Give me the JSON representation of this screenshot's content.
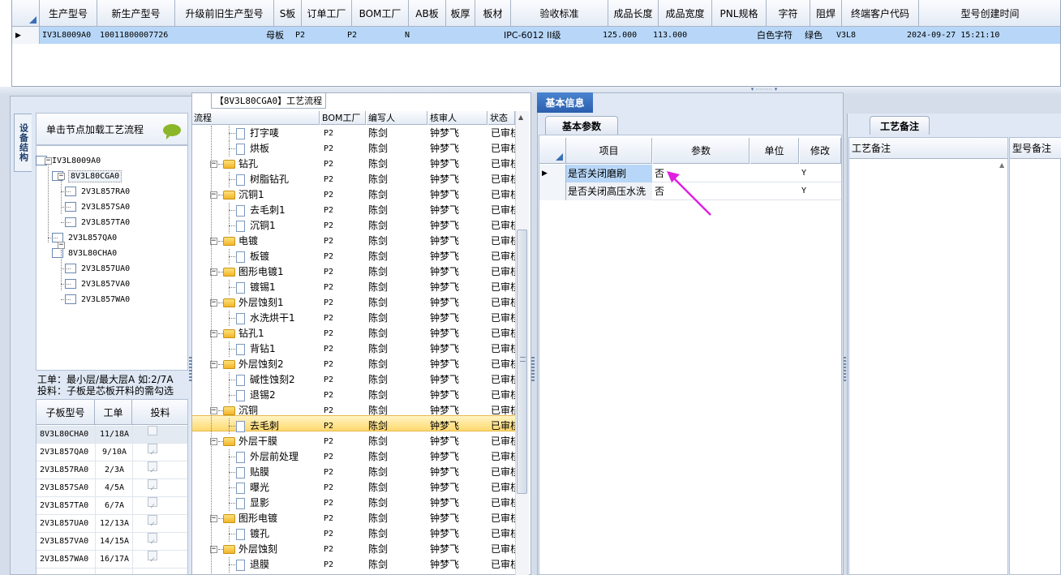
{
  "top_grid": {
    "headers": [
      "生产型号",
      "新生产型号",
      "升级前旧生产型号",
      "S板",
      "订单工厂",
      "BOM工厂",
      "AB板",
      "板厚",
      "板材",
      "验收标准",
      "成品长度",
      "成品宽度",
      "PNL规格",
      "字符",
      "阻焊",
      "终端客户代码",
      "型号创建时间"
    ],
    "row": {
      "model": "IV3L8009A0",
      "new_model": "10011800007726",
      "old_model": "",
      "s_board": "母板",
      "order_factory": "P2",
      "bom_factory": "P2",
      "ab": "N",
      "thickness": "",
      "material": "",
      "standard": "IPC-6012 II级",
      "length": "125.000",
      "width": "113.000",
      "pnl": "",
      "char": "白色字符",
      "mask": "绿色",
      "customer": "V3L8",
      "created": "2024-09-27 15:21:10"
    }
  },
  "left": {
    "vertical_tab": "设备结构",
    "hint": "单击节点加载工艺流程",
    "tree": [
      {
        "label": "IV3L8009A0"
      },
      {
        "label": "8V3L80CGA0"
      },
      {
        "label": "2V3L857RA0"
      },
      {
        "label": "2V3L857SA0"
      },
      {
        "label": "2V3L857TA0"
      },
      {
        "label": "2V3L857QA0"
      },
      {
        "label": "8V3L80CHA0"
      },
      {
        "label": "2V3L857UA0"
      },
      {
        "label": "2V3L857VA0"
      },
      {
        "label": "2V3L857WA0"
      }
    ],
    "note_line1": "工单：最小层/最大层A 如:2/7A",
    "note_line2": "投料：子板是芯板开料的需勾选",
    "sub_headers": [
      "子板型号",
      "工单",
      "投料"
    ],
    "sub_rows": [
      {
        "model": "8V3L80CHA0",
        "wo": "11/18A",
        "checked": false
      },
      {
        "model": "2V3L857QA0",
        "wo": "9/10A",
        "checked": true
      },
      {
        "model": "2V3L857RA0",
        "wo": "2/3A",
        "checked": true
      },
      {
        "model": "2V3L857SA0",
        "wo": "4/5A",
        "checked": true
      },
      {
        "model": "2V3L857TA0",
        "wo": "6/7A",
        "checked": true
      },
      {
        "model": "2V3L857UA0",
        "wo": "12/13A",
        "checked": true
      },
      {
        "model": "2V3L857VA0",
        "wo": "14/15A",
        "checked": true
      },
      {
        "model": "2V3L857WA0",
        "wo": "16/17A",
        "checked": true
      }
    ]
  },
  "process": {
    "title": "【8V3L80CGA0】工艺流程",
    "headers": [
      "流程",
      "BOM工厂",
      "编写人",
      "核审人",
      "状态"
    ],
    "rows": [
      {
        "name": "打字唛",
        "folder": false,
        "bom": "P2",
        "writer": "陈剑",
        "reviewer": "钟梦飞",
        "status": "已审核"
      },
      {
        "name": "烘板",
        "folder": false,
        "bom": "P2",
        "writer": "陈剑",
        "reviewer": "钟梦飞",
        "status": "已审核"
      },
      {
        "name": "钻孔",
        "folder": true,
        "bom": "P2",
        "writer": "陈剑",
        "reviewer": "钟梦飞",
        "status": "已审核"
      },
      {
        "name": "树脂钻孔",
        "folder": false,
        "bom": "P2",
        "writer": "陈剑",
        "reviewer": "钟梦飞",
        "status": "已审核"
      },
      {
        "name": "沉铜1",
        "folder": true,
        "bom": "P2",
        "writer": "陈剑",
        "reviewer": "钟梦飞",
        "status": "已审核"
      },
      {
        "name": "去毛刺1",
        "folder": false,
        "bom": "P2",
        "writer": "陈剑",
        "reviewer": "钟梦飞",
        "status": "已审核"
      },
      {
        "name": "沉铜1",
        "folder": false,
        "bom": "P2",
        "writer": "陈剑",
        "reviewer": "钟梦飞",
        "status": "已审核"
      },
      {
        "name": "电镀",
        "folder": true,
        "bom": "P2",
        "writer": "陈剑",
        "reviewer": "钟梦飞",
        "status": "已审核"
      },
      {
        "name": "板镀",
        "folder": false,
        "bom": "P2",
        "writer": "陈剑",
        "reviewer": "钟梦飞",
        "status": "已审核"
      },
      {
        "name": "图形电镀1",
        "folder": true,
        "bom": "P2",
        "writer": "陈剑",
        "reviewer": "钟梦飞",
        "status": "已审核"
      },
      {
        "name": "镀锡1",
        "folder": false,
        "bom": "P2",
        "writer": "陈剑",
        "reviewer": "钟梦飞",
        "status": "已审核"
      },
      {
        "name": "外层蚀刻1",
        "folder": true,
        "bom": "P2",
        "writer": "陈剑",
        "reviewer": "钟梦飞",
        "status": "已审核"
      },
      {
        "name": "水洗烘干1",
        "folder": false,
        "bom": "P2",
        "writer": "陈剑",
        "reviewer": "钟梦飞",
        "status": "已审核"
      },
      {
        "name": "钻孔1",
        "folder": true,
        "bom": "P2",
        "writer": "陈剑",
        "reviewer": "钟梦飞",
        "status": "已审核"
      },
      {
        "name": "背钻1",
        "folder": false,
        "bom": "P2",
        "writer": "陈剑",
        "reviewer": "钟梦飞",
        "status": "已审核"
      },
      {
        "name": "外层蚀刻2",
        "folder": true,
        "bom": "P2",
        "writer": "陈剑",
        "reviewer": "钟梦飞",
        "status": "已审核"
      },
      {
        "name": "碱性蚀刻2",
        "folder": false,
        "bom": "P2",
        "writer": "陈剑",
        "reviewer": "钟梦飞",
        "status": "已审核"
      },
      {
        "name": "退锡2",
        "folder": false,
        "bom": "P2",
        "writer": "陈剑",
        "reviewer": "钟梦飞",
        "status": "已审核"
      },
      {
        "name": "沉铜",
        "folder": true,
        "bom": "P2",
        "writer": "陈剑",
        "reviewer": "钟梦飞",
        "status": "已审核"
      },
      {
        "name": "去毛刺",
        "folder": false,
        "bom": "P2",
        "writer": "陈剑",
        "reviewer": "钟梦飞",
        "status": "已审核",
        "selected": true
      },
      {
        "name": "外层干膜",
        "folder": true,
        "bom": "P2",
        "writer": "陈剑",
        "reviewer": "钟梦飞",
        "status": "已审核"
      },
      {
        "name": "外层前处理",
        "folder": false,
        "bom": "P2",
        "writer": "陈剑",
        "reviewer": "钟梦飞",
        "status": "已审核"
      },
      {
        "name": "贴膜",
        "folder": false,
        "bom": "P2",
        "writer": "陈剑",
        "reviewer": "钟梦飞",
        "status": "已审核"
      },
      {
        "name": "曝光",
        "folder": false,
        "bom": "P2",
        "writer": "陈剑",
        "reviewer": "钟梦飞",
        "status": "已审核"
      },
      {
        "name": "显影",
        "folder": false,
        "bom": "P2",
        "writer": "陈剑",
        "reviewer": "钟梦飞",
        "status": "已审核"
      },
      {
        "name": "图形电镀",
        "folder": true,
        "bom": "P2",
        "writer": "陈剑",
        "reviewer": "钟梦飞",
        "status": "已审核"
      },
      {
        "name": "镀孔",
        "folder": false,
        "bom": "P2",
        "writer": "陈剑",
        "reviewer": "钟梦飞",
        "status": "已审核"
      },
      {
        "name": "外层蚀刻",
        "folder": true,
        "bom": "P2",
        "writer": "陈剑",
        "reviewer": "钟梦飞",
        "status": "已审核"
      },
      {
        "name": "退膜",
        "folder": false,
        "bom": "P2",
        "writer": "陈剑",
        "reviewer": "钟梦飞",
        "status": "已审核"
      }
    ]
  },
  "basic": {
    "tab": "基本信息",
    "subtab": "基本参数",
    "headers": [
      "项目",
      "参数",
      "单位",
      "修改"
    ],
    "rows": [
      {
        "item": "是否关闭磨刷",
        "param": "否",
        "unit": "",
        "edit": "Y"
      },
      {
        "item": "是否关闭高压水洗",
        "param": "否",
        "unit": "",
        "edit": "Y"
      }
    ]
  },
  "notes": {
    "tab": "工艺备注",
    "col1": "工艺备注",
    "col2": "型号备注"
  },
  "colors": {
    "selection": "#b8d7f8",
    "accent": "#2a5fae",
    "annotation_arrow": "#e020e0"
  }
}
